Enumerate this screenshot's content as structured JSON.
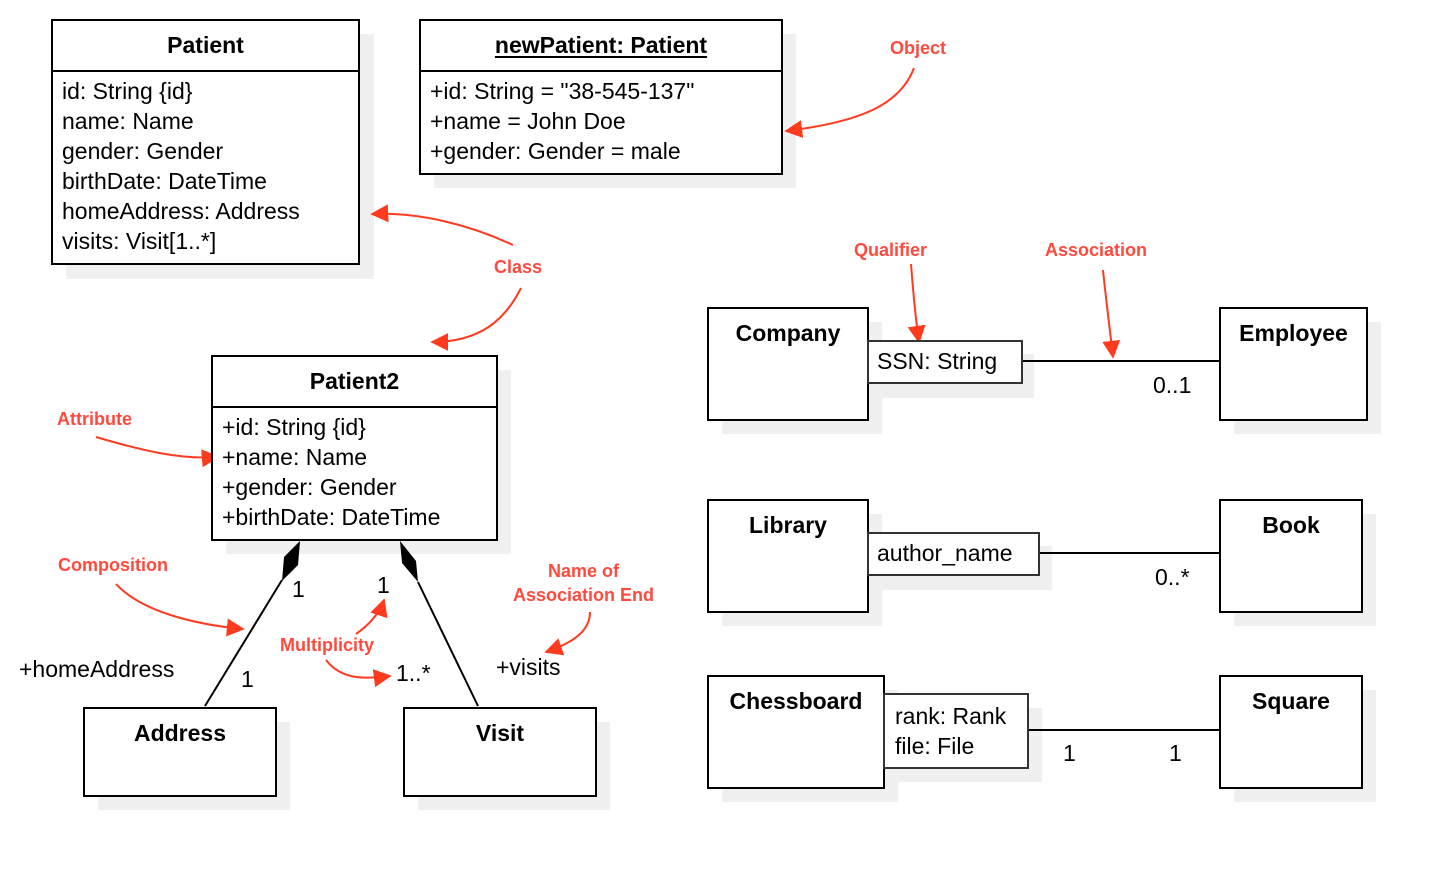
{
  "colors": {
    "annotation": "#ff3b1f",
    "annotation_text": "#ff4a3d",
    "line": "#000000",
    "shadow": "#f0f0f0"
  },
  "classes": {
    "patient": {
      "name": "Patient",
      "attributes": [
        "id: String {id}",
        "name: Name",
        "gender: Gender",
        "birthDate: DateTime",
        "homeAddress: Address",
        "visits: Visit[1..*]"
      ]
    },
    "new_patient": {
      "name": "newPatient: Patient",
      "attributes": [
        "+id: String = \"38-545-137\"",
        "+name = John Doe",
        "+gender: Gender = male"
      ]
    },
    "patient2": {
      "name": "Patient2",
      "attributes": [
        "+id: String {id}",
        "+name: Name",
        "+gender: Gender",
        "+birthDate: DateTime"
      ]
    },
    "address": {
      "name": "Address"
    },
    "visit": {
      "name": "Visit"
    },
    "company": {
      "name": "Company"
    },
    "employee": {
      "name": "Employee"
    },
    "library": {
      "name": "Library"
    },
    "book": {
      "name": "Book"
    },
    "chessboard": {
      "name": "Chessboard"
    },
    "square": {
      "name": "Square"
    }
  },
  "qualifiers": {
    "company": [
      "SSN: String"
    ],
    "library": [
      "author_name"
    ],
    "chessboard": [
      "rank: Rank",
      "file: File"
    ]
  },
  "associations": {
    "patient2_address": {
      "type": "composition",
      "whole_multiplicity": "1",
      "part_multiplicity": "1",
      "role": "+homeAddress"
    },
    "patient2_visit": {
      "type": "composition",
      "whole_multiplicity": "1",
      "part_multiplicity": "1..*",
      "role": "+visits"
    },
    "company_employee": {
      "type": "qualified association",
      "multiplicity": "0..1"
    },
    "library_book": {
      "type": "qualified association",
      "multiplicity": "0..*"
    },
    "chessboard_square": {
      "type": "qualified association",
      "source_multiplicity": "1",
      "target_multiplicity": "1"
    }
  },
  "annotations": {
    "object": "Object",
    "class": "Class",
    "attribute": "Attribute",
    "composition": "Composition",
    "multiplicity": "Multiplicity",
    "association_end": [
      "Name of",
      "Association End"
    ],
    "qualifier": "Qualifier",
    "association": "Association"
  }
}
